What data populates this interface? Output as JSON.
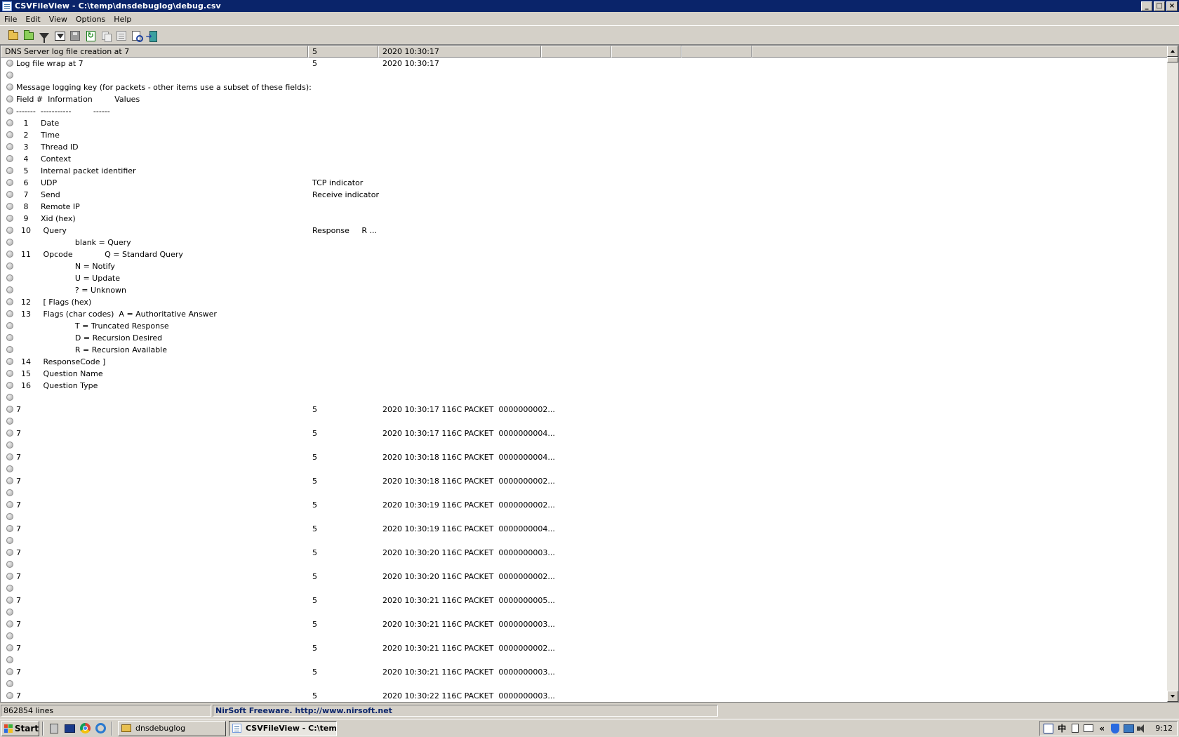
{
  "window": {
    "title": "CSVFileView  -  C:\\temp\\dnsdebuglog\\debug.csv",
    "controls": {
      "minimize": "_",
      "maximize": "□",
      "close": "×"
    }
  },
  "menu": [
    "File",
    "Edit",
    "View",
    "Options",
    "Help"
  ],
  "toolbar": {
    "icons": [
      "open-file-icon",
      "open-folder-icon",
      "filter-icon",
      "advanced-filter-icon",
      "save-icon",
      "refresh-icon",
      "copy-icon",
      "properties-icon",
      "find-icon",
      "exit-icon"
    ]
  },
  "columns": [
    "DNS Server log file creation at 7",
    "5",
    "2020 10:30:17",
    "",
    "",
    "",
    ""
  ],
  "rows": [
    [
      "Log file wrap at 7",
      "5",
      "2020 10:30:17"
    ],
    [
      "",
      "",
      ""
    ],
    [
      "Message logging key (for packets - other items use a subset of these fields):",
      "",
      ""
    ],
    [
      "Field #  Information         Values",
      "",
      ""
    ],
    [
      "-------  -----------         ------",
      "",
      ""
    ],
    [
      "   1     Date",
      "",
      ""
    ],
    [
      "   2     Time",
      "",
      ""
    ],
    [
      "   3     Thread ID",
      "",
      ""
    ],
    [
      "   4     Context",
      "",
      ""
    ],
    [
      "   5     Internal packet identifier",
      "",
      ""
    ],
    [
      "   6     UDP",
      "TCP indicator",
      ""
    ],
    [
      "   7     Send",
      "Receive indicator",
      ""
    ],
    [
      "   8     Remote IP",
      "",
      ""
    ],
    [
      "   9     Xid (hex)",
      "",
      ""
    ],
    [
      "  10     Query",
      "Response     R ...",
      ""
    ],
    [
      "                        blank = Query",
      "",
      ""
    ],
    [
      "  11     Opcode             Q = Standard Query",
      "",
      ""
    ],
    [
      "                        N = Notify",
      "",
      ""
    ],
    [
      "                        U = Update",
      "",
      ""
    ],
    [
      "                        ? = Unknown",
      "",
      ""
    ],
    [
      "  12     [ Flags (hex)",
      "",
      ""
    ],
    [
      "  13     Flags (char codes)  A = Authoritative Answer",
      "",
      ""
    ],
    [
      "                        T = Truncated Response",
      "",
      ""
    ],
    [
      "                        D = Recursion Desired",
      "",
      ""
    ],
    [
      "                        R = Recursion Available",
      "",
      ""
    ],
    [
      "  14     ResponseCode ]",
      "",
      ""
    ],
    [
      "  15     Question Name",
      "",
      ""
    ],
    [
      "  16     Question Type",
      "",
      ""
    ],
    [
      "",
      "",
      ""
    ],
    [
      "7",
      "5",
      "2020 10:30:17 116C PACKET  0000000002..."
    ],
    [
      "",
      "",
      ""
    ],
    [
      "7",
      "5",
      "2020 10:30:17 116C PACKET  0000000004..."
    ],
    [
      "",
      "",
      ""
    ],
    [
      "7",
      "5",
      "2020 10:30:18 116C PACKET  0000000004..."
    ],
    [
      "",
      "",
      ""
    ],
    [
      "7",
      "5",
      "2020 10:30:18 116C PACKET  0000000002..."
    ],
    [
      "",
      "",
      ""
    ],
    [
      "7",
      "5",
      "2020 10:30:19 116C PACKET  0000000002..."
    ],
    [
      "",
      "",
      ""
    ],
    [
      "7",
      "5",
      "2020 10:30:19 116C PACKET  0000000004..."
    ],
    [
      "",
      "",
      ""
    ],
    [
      "7",
      "5",
      "2020 10:30:20 116C PACKET  0000000003..."
    ],
    [
      "",
      "",
      ""
    ],
    [
      "7",
      "5",
      "2020 10:30:20 116C PACKET  0000000002..."
    ],
    [
      "",
      "",
      ""
    ],
    [
      "7",
      "5",
      "2020 10:30:21 116C PACKET  0000000005..."
    ],
    [
      "",
      "",
      ""
    ],
    [
      "7",
      "5",
      "2020 10:30:21 116C PACKET  0000000003..."
    ],
    [
      "",
      "",
      ""
    ],
    [
      "7",
      "5",
      "2020 10:30:21 116C PACKET  0000000002..."
    ],
    [
      "",
      "",
      ""
    ],
    [
      "7",
      "5",
      "2020 10:30:21 116C PACKET  0000000003..."
    ],
    [
      "",
      "",
      ""
    ],
    [
      "7",
      "5",
      "2020 10:30:22 116C PACKET  0000000003..."
    ]
  ],
  "status": {
    "lines": "862854 lines",
    "credit": "NirSoft Freeware.  http://www.nirsoft.net"
  },
  "taskbar": {
    "start": "Start",
    "tasks": [
      {
        "label": "dnsdebuglog",
        "icon": "folder-icon",
        "active": false
      },
      {
        "label": "CSVFileView  -  C:\\tem...",
        "icon": "csvfileview-icon",
        "active": true
      }
    ],
    "tray": {
      "ime": "中",
      "clock": "9:12"
    }
  },
  "colors": {
    "titlebar": "#0a246a",
    "face": "#d4d0c8",
    "credit_text": "#0a246a"
  }
}
